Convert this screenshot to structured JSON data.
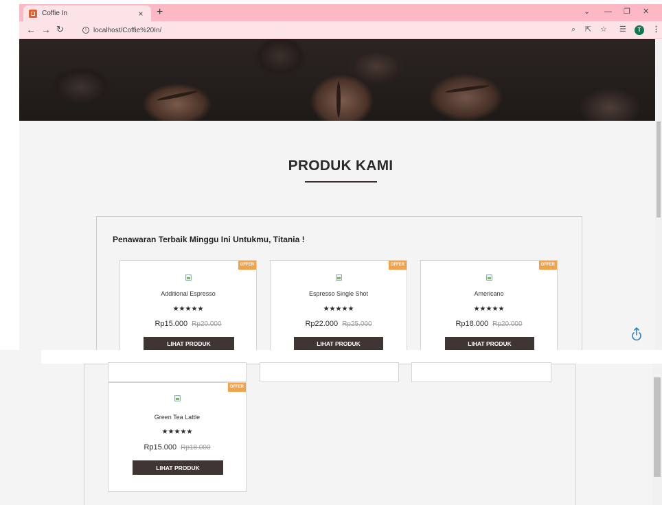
{
  "browser": {
    "tab_title": "Coffie In",
    "tab_close": "×",
    "new_tab": "+",
    "url": "localhost/Coffie%20In/",
    "avatar_letter": "T",
    "icons": [
      "back-icon",
      "forward-icon",
      "reload-icon",
      "info-icon",
      "zoom-icon",
      "share-icon",
      "star-icon",
      "reading-list-icon",
      "menu-icon"
    ]
  },
  "section": {
    "title": "PRODUK KAMI",
    "heading": "Penawaran Terbaik Minggu Ini Untukmu, Titania !"
  },
  "products": [
    {
      "name": "Additional Espresso",
      "stars": "★★★★★",
      "price": "Rp15.000",
      "old_price": "Rp20.000",
      "badge": "OFFER",
      "button": "LIHAT PRODUK"
    },
    {
      "name": "Espresso Single Shot",
      "stars": "★★★★★",
      "price": "Rp22.000",
      "old_price": "Rp25.000",
      "badge": "OFFER",
      "button": "LIHAT PRODUK"
    },
    {
      "name": "Americano",
      "stars": "★★★★★",
      "price": "Rp18.000",
      "old_price": "Rp20.000",
      "badge": "OFFER",
      "button": "LIHAT PRODUK"
    },
    {
      "name": "Green Tea Lattle",
      "stars": "★★★★★",
      "price": "Rp15.000",
      "old_price": "Rp18.000",
      "badge": "OFFER",
      "button": "LIHAT PRODUK"
    }
  ],
  "colors": {
    "tab_strip": "#fdb8c6",
    "button": "#3f3532",
    "offer_badge": "#f3a24c",
    "scroll_top_icon": "#2a7fc2"
  }
}
